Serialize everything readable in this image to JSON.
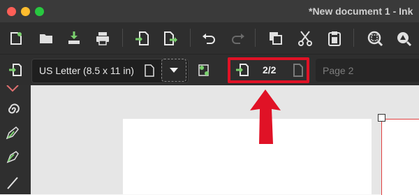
{
  "window": {
    "title": "*New document 1 - Ink",
    "traffic_lights": {
      "close": "#fe5f57",
      "minimize": "#febc2e",
      "maximize": "#28c840"
    }
  },
  "toolbar": {
    "icons": [
      "new-document-icon",
      "open-folder-icon",
      "save-icon",
      "print-icon",
      "import-icon",
      "export-icon",
      "undo-icon",
      "redo-icon",
      "duplicate-icon",
      "cut-icon",
      "paste-icon",
      "zoom-selection-icon",
      "zoom-drawing-icon"
    ]
  },
  "page_toolbar": {
    "paper_size": "US Letter (8.5 x 11 in)",
    "page_counter": "2/2",
    "page_label_placeholder": "Page 2"
  },
  "annotation": {
    "highlight_color": "#e01226",
    "arrow_color": "#e01226"
  },
  "colors": {
    "accent_green": "#7ad06d",
    "toolbar_bg": "#2e2e2e"
  }
}
